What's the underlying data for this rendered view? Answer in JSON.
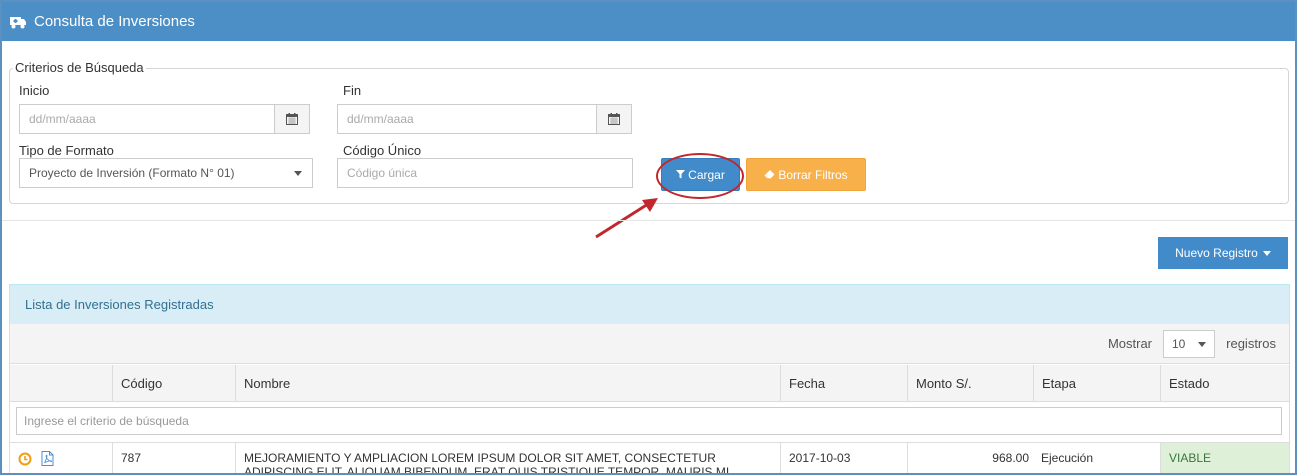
{
  "header": {
    "title": "Consulta de Inversiones",
    "icon": "ambulance-icon"
  },
  "criteria": {
    "legend": "Criterios de Búsqueda",
    "inicio_label": "Inicio",
    "inicio_placeholder": "dd/mm/aaaa",
    "fin_label": "Fin",
    "fin_placeholder": "dd/mm/aaaa",
    "tipo_label": "Tipo de Formato",
    "tipo_value": "Proyecto de Inversión (Formato N° 01)",
    "codigo_label": "Código Único",
    "codigo_placeholder": "Código única",
    "cargar_label": "Cargar",
    "borrar_label": "Borrar Filtros"
  },
  "nuevo_registro_label": "Nuevo Registro",
  "list": {
    "title": "Lista de Inversiones Registradas",
    "mostrar_label": "Mostrar",
    "page_size": "10",
    "registros_label": "registros",
    "columns": [
      "",
      "Código",
      "Nombre",
      "Fecha",
      "Monto S/.",
      "Etapa",
      "Estado"
    ],
    "filter_placeholder": "Ingrese el criterio de búsqueda",
    "rows": [
      {
        "codigo": "787",
        "nombre": "MEJORAMIENTO Y AMPLIACION LOREM IPSUM DOLOR SIT AMET, CONSECTETUR ADIPISCING ELIT. ALIQUAM BIBENDUM, ERAT QUIS TRISTIQUE TEMPOR, MAURIS MI",
        "fecha": "2017-10-03",
        "monto": "968.00",
        "etapa": "Ejecución",
        "estado": "VIABLE"
      }
    ]
  },
  "colors": {
    "header_bg": "#4c8fc6",
    "primary": "#428bca",
    "warning": "#f8b04a",
    "annotation": "#c0282d",
    "viable_bg": "#dff0d8"
  }
}
